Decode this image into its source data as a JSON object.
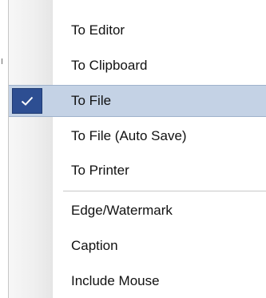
{
  "menu": {
    "items": [
      {
        "label": "To Editor",
        "checked": false
      },
      {
        "label": "To Clipboard",
        "checked": false
      },
      {
        "label": "To File",
        "checked": true
      },
      {
        "label": "To File (Auto Save)",
        "checked": false
      },
      {
        "label": "To Printer",
        "checked": false
      },
      {
        "label": "Edge/Watermark",
        "checked": false
      },
      {
        "label": "Caption",
        "checked": false
      },
      {
        "label": "Include Mouse",
        "checked": false
      }
    ],
    "selected_highlight_color": "#c4d2e5",
    "check_icon": "checkmark-icon"
  }
}
